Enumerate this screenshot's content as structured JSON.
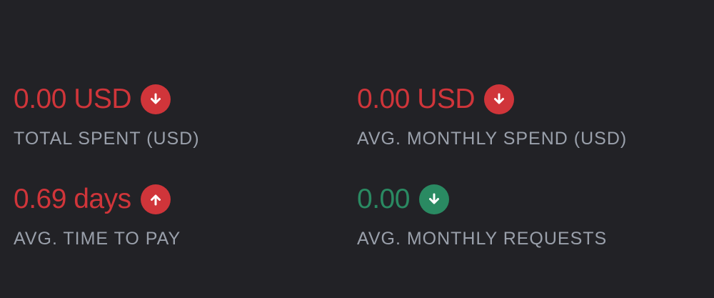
{
  "colors": {
    "background": "#222226",
    "negative": "#d0353a",
    "positive": "#2a8a62",
    "label": "#9aa0ab",
    "arrow": "#ffffff"
  },
  "stats": [
    {
      "value": "0.00 USD",
      "label": "TOTAL SPENT (USD)",
      "trend": "down",
      "status": "negative",
      "icon": "arrow-down-circle-icon"
    },
    {
      "value": "0.00 USD",
      "label": "AVG. MONTHLY SPEND (USD)",
      "trend": "down",
      "status": "negative",
      "icon": "arrow-down-circle-icon"
    },
    {
      "value": "0.69 days",
      "label": "AVG. TIME TO PAY",
      "trend": "up",
      "status": "negative",
      "icon": "arrow-up-circle-icon"
    },
    {
      "value": "0.00",
      "label": "AVG. MONTHLY REQUESTS",
      "trend": "down",
      "status": "positive",
      "icon": "arrow-down-circle-icon"
    }
  ]
}
